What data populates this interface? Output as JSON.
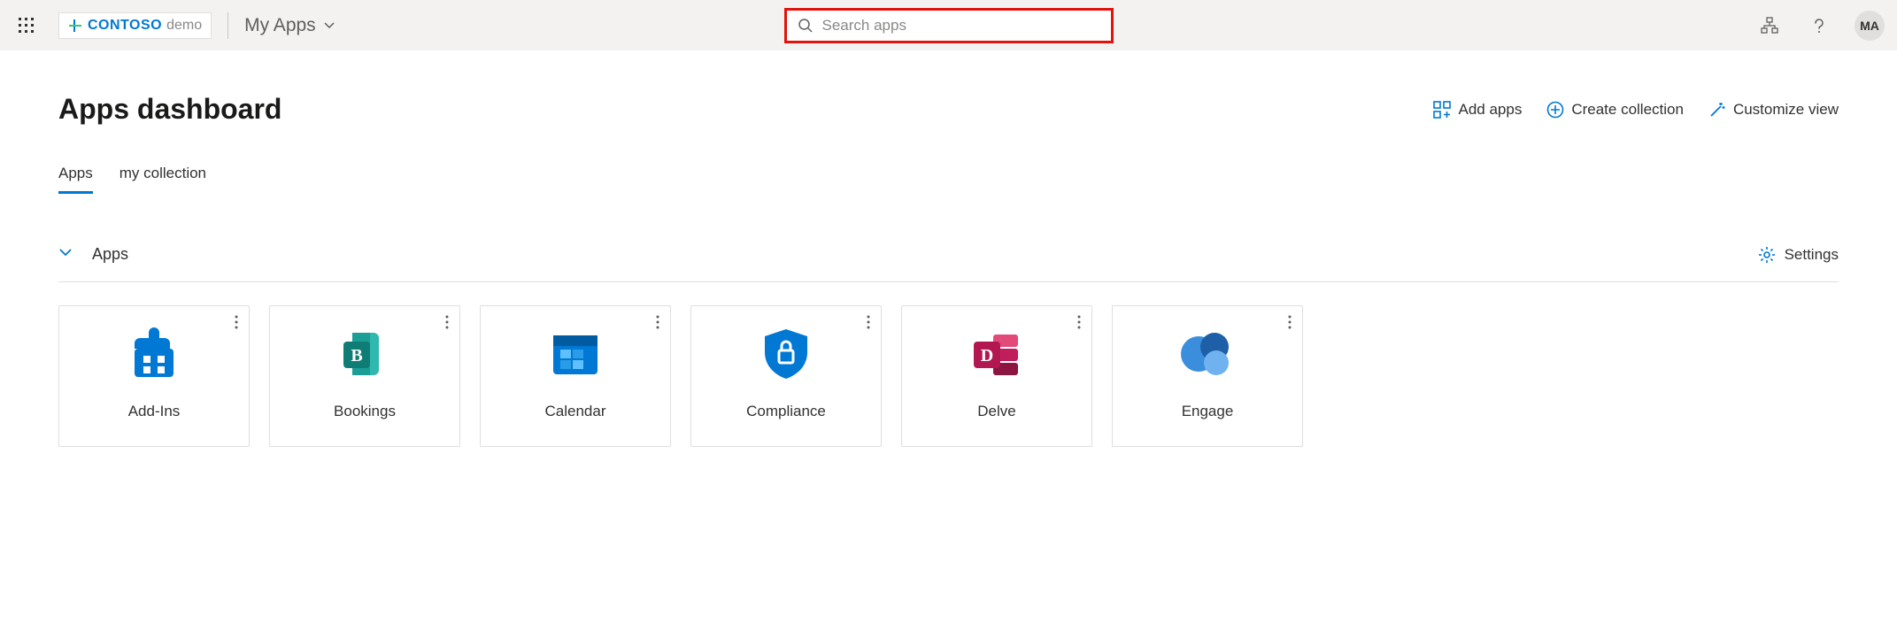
{
  "header": {
    "brand_name": "CONTOSO",
    "brand_suffix": "demo",
    "nav_label": "My Apps",
    "search_placeholder": "Search apps",
    "avatar_initials": "MA"
  },
  "page": {
    "title": "Apps dashboard"
  },
  "actions": {
    "add_apps": "Add apps",
    "create_collection": "Create collection",
    "customize_view": "Customize view"
  },
  "tabs": [
    {
      "label": "Apps",
      "active": true
    },
    {
      "label": "my collection",
      "active": false
    }
  ],
  "section": {
    "title": "Apps",
    "settings_label": "Settings"
  },
  "apps": [
    {
      "label": "Add-Ins",
      "icon": "addins"
    },
    {
      "label": "Bookings",
      "icon": "bookings"
    },
    {
      "label": "Calendar",
      "icon": "calendar"
    },
    {
      "label": "Compliance",
      "icon": "compliance"
    },
    {
      "label": "Delve",
      "icon": "delve"
    },
    {
      "label": "Engage",
      "icon": "engage"
    }
  ],
  "colors": {
    "accent": "#0078d4",
    "highlight_border": "#e3120b"
  }
}
